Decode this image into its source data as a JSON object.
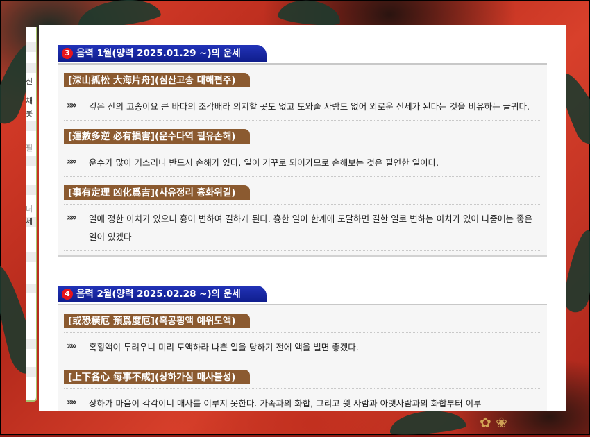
{
  "sections": [
    {
      "num": "3",
      "title": "음력 1월(양력 2025.01.29 ~)의 운세",
      "items": [
        {
          "title": "[深山孤松 大海片舟](심산고송 대해편주)",
          "text": "깊은 산의 고송이요 큰 바다의 조각배라 의지할 곳도 없고 도와줄 사람도 없어 외로운 신세가 된다는 것을 비유하는 글귀다."
        },
        {
          "title": "[運數多逆 必有損害](운수다역 필유손해)",
          "text": "운수가 많이 거스리니 반드시 손해가 있다. 일이 거꾸로 되어가므로 손해보는 것은 필연한 일이다."
        },
        {
          "title": "[事有定理 凶化爲吉](사유정리 흉화위길)",
          "text": "일에 정한 이치가 있으니 흉이 변하여 길하게 된다. 흉한 일이 한계에 도달하면 길한 일로 변하는 이치가 있어 나중에는 좋은 일이 있겠다"
        }
      ]
    },
    {
      "num": "4",
      "title": "음력 2월(양력 2025.02.28 ~)의 운세",
      "items": [
        {
          "title": "[或恐橫厄 預爲度厄](혹공횡액 예위도액)",
          "text": "혹횡액이 두려우니 미리 도액하라 나쁜 일을 당하기 전에 액을 빌면 좋겠다."
        },
        {
          "title": "[上下各心 每事不成](상하가심 매사불성)",
          "text": "상하가 마음이 각각이니 매사를 이루지 못한다. 가족과의 화합, 그리고 윗 사람과 아랫사람과의 화합부터 이루"
        }
      ]
    }
  ],
  "sidebar_fragments": [
    "신",
    "채",
    "롯",
    "필",
    "녀",
    "세"
  ],
  "icons": {
    "bullet": "double-chevron-right-icon"
  },
  "colors": {
    "tab": "#1a2aa8",
    "number_badge": "#e8141a",
    "item_title_bg": "#8b5a30",
    "sidebar_border": "#a7c46f"
  }
}
